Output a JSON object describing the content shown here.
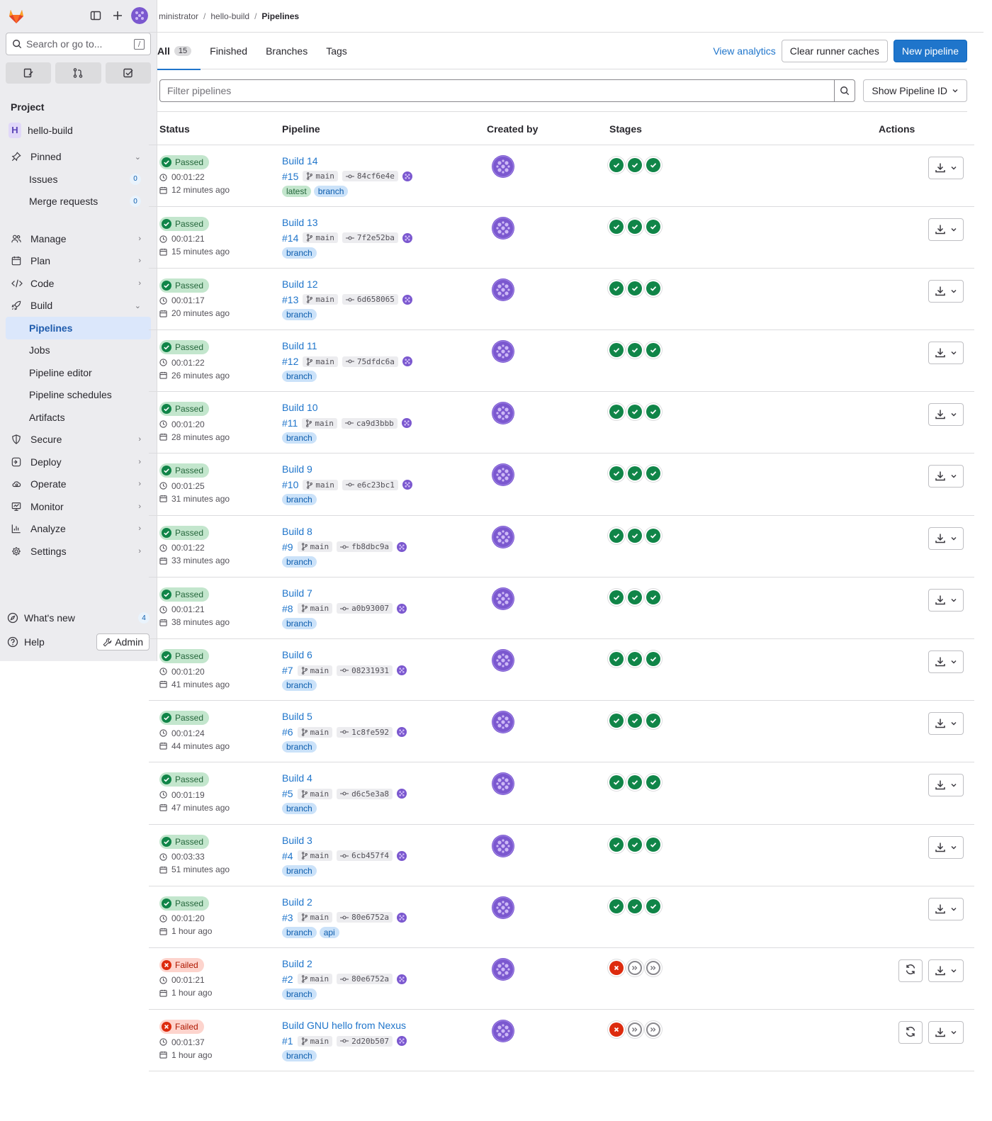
{
  "sidebar": {
    "search_placeholder": "Search or go to...",
    "search_kbd": "/",
    "section_project": "Project",
    "project_initial": "H",
    "project_name": "hello-build",
    "pinned": {
      "label": "Pinned",
      "items": [
        {
          "label": "Issues",
          "count": "0"
        },
        {
          "label": "Merge requests",
          "count": "0"
        }
      ]
    },
    "groups": [
      {
        "label": "Manage",
        "icon": "users-icon"
      },
      {
        "label": "Plan",
        "icon": "planning-icon"
      },
      {
        "label": "Code",
        "icon": "code-icon"
      },
      {
        "label": "Build",
        "icon": "rocket-icon"
      }
    ],
    "build_items": [
      "Pipelines",
      "Jobs",
      "Pipeline editor",
      "Pipeline schedules",
      "Artifacts"
    ],
    "after_groups": [
      {
        "label": "Secure",
        "icon": "shield-icon"
      },
      {
        "label": "Deploy",
        "icon": "deploy-icon"
      },
      {
        "label": "Operate",
        "icon": "cloud-gear-icon"
      },
      {
        "label": "Monitor",
        "icon": "monitor-icon"
      },
      {
        "label": "Analyze",
        "icon": "chart-icon"
      },
      {
        "label": "Settings",
        "icon": "gear-icon"
      }
    ],
    "whats_new": {
      "label": "What's new",
      "count": "4"
    },
    "help": "Help",
    "admin": "Admin"
  },
  "breadcrumb": {
    "items": [
      "ministrator",
      "hello-build"
    ],
    "current": "Pipelines"
  },
  "tabs": [
    {
      "label": "All",
      "count": "15"
    },
    {
      "label": "Finished"
    },
    {
      "label": "Branches"
    },
    {
      "label": "Tags"
    }
  ],
  "toolbar": {
    "view_analytics": "View analytics",
    "clear_caches": "Clear runner caches",
    "new_pipeline": "New pipeline"
  },
  "filter": {
    "placeholder": "Filter pipelines",
    "show_id": "Show Pipeline ID"
  },
  "table": {
    "headers": {
      "status": "Status",
      "pipeline": "Pipeline",
      "created_by": "Created by",
      "stages": "Stages",
      "actions": "Actions"
    },
    "rows": [
      {
        "status": "Passed",
        "duration": "00:01:22",
        "ago": "12 minutes ago",
        "name": "Build 14",
        "id": "#15",
        "branch": "main",
        "sha": "84cf6e4e",
        "tags": [
          "latest",
          "branch"
        ],
        "stages": [
          "ok",
          "ok",
          "ok"
        ]
      },
      {
        "status": "Passed",
        "duration": "00:01:21",
        "ago": "15 minutes ago",
        "name": "Build 13",
        "id": "#14",
        "branch": "main",
        "sha": "7f2e52ba",
        "tags": [
          "branch"
        ],
        "stages": [
          "ok",
          "ok",
          "ok"
        ]
      },
      {
        "status": "Passed",
        "duration": "00:01:17",
        "ago": "20 minutes ago",
        "name": "Build 12",
        "id": "#13",
        "branch": "main",
        "sha": "6d658065",
        "tags": [
          "branch"
        ],
        "stages": [
          "ok",
          "ok",
          "ok"
        ]
      },
      {
        "status": "Passed",
        "duration": "00:01:22",
        "ago": "26 minutes ago",
        "name": "Build 11",
        "id": "#12",
        "branch": "main",
        "sha": "75dfdc6a",
        "tags": [
          "branch"
        ],
        "stages": [
          "ok",
          "ok",
          "ok"
        ]
      },
      {
        "status": "Passed",
        "duration": "00:01:20",
        "ago": "28 minutes ago",
        "name": "Build 10",
        "id": "#11",
        "branch": "main",
        "sha": "ca9d3bbb",
        "tags": [
          "branch"
        ],
        "stages": [
          "ok",
          "ok",
          "ok"
        ]
      },
      {
        "status": "Passed",
        "duration": "00:01:25",
        "ago": "31 minutes ago",
        "name": "Build 9",
        "id": "#10",
        "branch": "main",
        "sha": "e6c23bc1",
        "tags": [
          "branch"
        ],
        "stages": [
          "ok",
          "ok",
          "ok"
        ]
      },
      {
        "status": "Passed",
        "duration": "00:01:22",
        "ago": "33 minutes ago",
        "name": "Build 8",
        "id": "#9",
        "branch": "main",
        "sha": "fb8dbc9a",
        "tags": [
          "branch"
        ],
        "stages": [
          "ok",
          "ok",
          "ok"
        ]
      },
      {
        "status": "Passed",
        "duration": "00:01:21",
        "ago": "38 minutes ago",
        "name": "Build 7",
        "id": "#8",
        "branch": "main",
        "sha": "a0b93007",
        "tags": [
          "branch"
        ],
        "stages": [
          "ok",
          "ok",
          "ok"
        ]
      },
      {
        "status": "Passed",
        "duration": "00:01:20",
        "ago": "41 minutes ago",
        "name": "Build 6",
        "id": "#7",
        "branch": "main",
        "sha": "08231931",
        "tags": [
          "branch"
        ],
        "stages": [
          "ok",
          "ok",
          "ok"
        ]
      },
      {
        "status": "Passed",
        "duration": "00:01:24",
        "ago": "44 minutes ago",
        "name": "Build 5",
        "id": "#6",
        "branch": "main",
        "sha": "1c8fe592",
        "tags": [
          "branch"
        ],
        "stages": [
          "ok",
          "ok",
          "ok"
        ]
      },
      {
        "status": "Passed",
        "duration": "00:01:19",
        "ago": "47 minutes ago",
        "name": "Build 4",
        "id": "#5",
        "branch": "main",
        "sha": "d6c5e3a8",
        "tags": [
          "branch"
        ],
        "stages": [
          "ok",
          "ok",
          "ok"
        ]
      },
      {
        "status": "Passed",
        "duration": "00:03:33",
        "ago": "51 minutes ago",
        "name": "Build 3",
        "id": "#4",
        "branch": "main",
        "sha": "6cb457f4",
        "tags": [
          "branch"
        ],
        "stages": [
          "ok",
          "ok",
          "ok"
        ]
      },
      {
        "status": "Passed",
        "duration": "00:01:20",
        "ago": "1 hour ago",
        "name": "Build 2",
        "id": "#3",
        "branch": "main",
        "sha": "80e6752a",
        "tags": [
          "branch",
          "api"
        ],
        "stages": [
          "ok",
          "ok",
          "ok"
        ]
      },
      {
        "status": "Failed",
        "duration": "00:01:21",
        "ago": "1 hour ago",
        "name": "Build 2",
        "id": "#2",
        "branch": "main",
        "sha": "80e6752a",
        "tags": [
          "branch"
        ],
        "stages": [
          "fail",
          "skip",
          "skip"
        ]
      },
      {
        "status": "Failed",
        "duration": "00:01:37",
        "ago": "1 hour ago",
        "name": "Build GNU hello from Nexus",
        "id": "#1",
        "branch": "main",
        "sha": "2d20b507",
        "tags": [
          "branch"
        ],
        "stages": [
          "fail",
          "skip",
          "skip"
        ]
      }
    ]
  },
  "colors": {
    "accent": "#1f75cb",
    "passed": "#108548",
    "failed": "#dd2b0e",
    "sidebar_bg": "#ececef",
    "avatar": "#7b58cf"
  }
}
